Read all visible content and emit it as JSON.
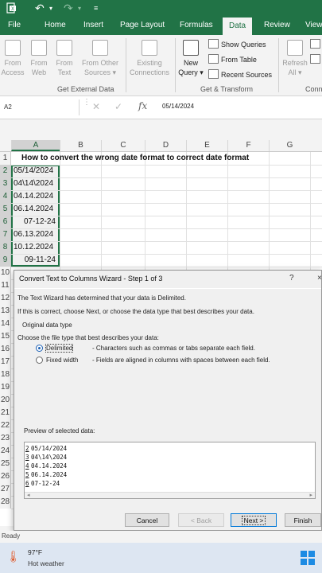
{
  "titlebar": {
    "file_icon": "excel-file-icon",
    "undo_icon": "undo-icon",
    "redo_icon": "redo-icon",
    "qat_icon": "customize-quick-access-icon"
  },
  "tabs": [
    "File",
    "Home",
    "Insert",
    "Page Layout",
    "Formulas",
    "Data",
    "Review",
    "View"
  ],
  "active_tab": "Data",
  "ribbon": {
    "get_external_data": {
      "label": "Get External Data",
      "buttons": [
        {
          "line1": "From",
          "line2": "Access"
        },
        {
          "line1": "From",
          "line2": "Web"
        },
        {
          "line1": "From",
          "line2": "Text"
        },
        {
          "line1": "From Other",
          "line2": "Sources ▾"
        },
        {
          "line1": "Existing",
          "line2": "Connections"
        }
      ]
    },
    "get_transform": {
      "label": "Get & Transform",
      "new_query_line1": "New",
      "new_query_line2": "Query ▾",
      "show_queries": "Show Queries",
      "from_table": "From Table",
      "recent_sources": "Recent Sources"
    },
    "connections": {
      "refresh_line1": "Refresh",
      "refresh_line2": "All ▾",
      "label": "Conn"
    }
  },
  "formula_bar": {
    "name_box": "A2",
    "fx": "fx",
    "value": "05/14/2024"
  },
  "columns": [
    "A",
    "B",
    "C",
    "D",
    "E",
    "F",
    "G"
  ],
  "rows": [
    "1",
    "2",
    "3",
    "4",
    "5",
    "6",
    "7",
    "8",
    "9",
    "10",
    "11",
    "12",
    "13",
    "14",
    "15",
    "16",
    "17",
    "18",
    "19",
    "20",
    "21",
    "22",
    "23",
    "24",
    "25",
    "26",
    "27",
    "28"
  ],
  "sheet_title": "How to convert the wrong date format to correct date format",
  "cells": [
    "05/14/2024",
    "04\\14\\2024",
    "04.14.2024",
    "06.14.2024",
    "07-12-24",
    "06.13.2024",
    "10.12.2024",
    "09-11-24"
  ],
  "dialog": {
    "title": "Convert Text to Columns Wizard - Step 1 of 3",
    "help": "?",
    "close": "×",
    "line1": "The Text Wizard has determined that your data is Delimited.",
    "line2": "If this is correct, choose Next, or choose the data type that best describes your data.",
    "group_label": "Original data type",
    "choose_label": "Choose the file type that best describes your data:",
    "options": [
      {
        "label": "Delimited",
        "desc": "- Characters such as commas or tabs separate each field.",
        "selected": true
      },
      {
        "label": "Fixed width",
        "desc": "- Fields are aligned in columns with spaces between each field.",
        "selected": false
      }
    ],
    "preview_label": "Preview of selected data:",
    "preview_lines": [
      {
        "n": "2",
        "text": "05/14/2024"
      },
      {
        "n": "3",
        "text": "04\\14\\2024"
      },
      {
        "n": "4",
        "text": "04.14.2024"
      },
      {
        "n": "5",
        "text": "06.14.2024"
      },
      {
        "n": "6",
        "text": "07-12-24"
      }
    ],
    "buttons": {
      "cancel": "Cancel",
      "back": "< Back",
      "next": "Next >",
      "finish": "Finish"
    }
  },
  "status": {
    "text": "Ready"
  },
  "taskbar": {
    "temperature": "97°F",
    "weather": "Hot weather"
  }
}
